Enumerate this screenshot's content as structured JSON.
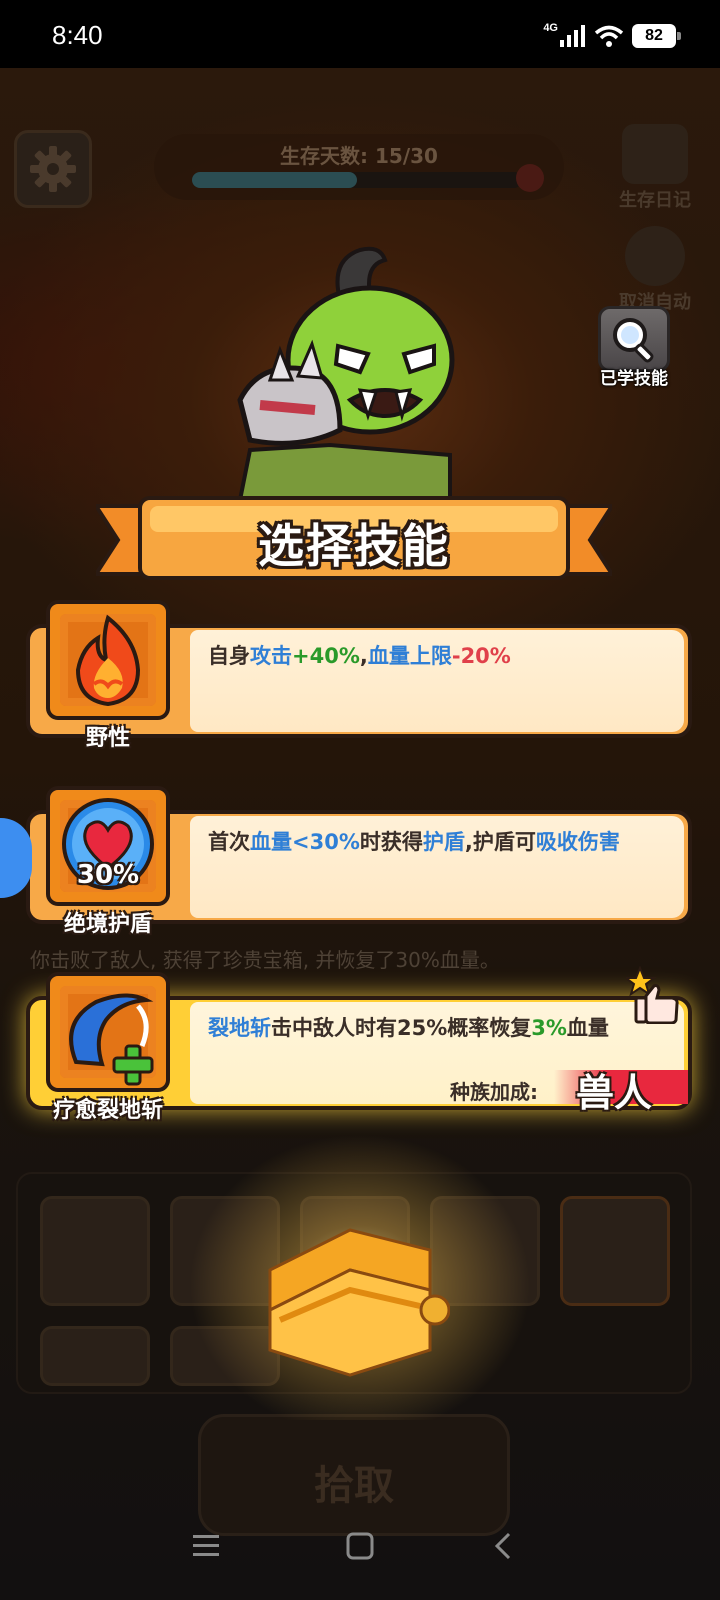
{
  "status_bar": {
    "time": "8:40",
    "network": "4G",
    "battery": "82"
  },
  "hud": {
    "survival_days_label": "生存天数: 15/30",
    "survival_progress": 0.5,
    "diary_label": "生存日记",
    "cancel_auto_label": "取消自动",
    "learned_skills_label": "已学技能"
  },
  "dialog": {
    "title": "选择技能",
    "skills": [
      {
        "name": "野性",
        "icon": "fire-icon",
        "desc_parts": [
          {
            "text": "自身",
            "color": "dark"
          },
          {
            "text": "攻击",
            "color": "blue"
          },
          {
            "text": "+40%",
            "color": "green"
          },
          {
            "text": ",",
            "color": "dark"
          },
          {
            "text": "血量上限",
            "color": "blue"
          },
          {
            "text": "-20%",
            "color": "red"
          }
        ]
      },
      {
        "name": "绝境护盾",
        "icon": "heart-shield-icon",
        "icon_text": "30%",
        "desc_parts": [
          {
            "text": "首次",
            "color": "dark"
          },
          {
            "text": "血量<30%",
            "color": "blue"
          },
          {
            "text": "时获得",
            "color": "dark"
          },
          {
            "text": "护盾",
            "color": "blue"
          },
          {
            "text": ",护盾可",
            "color": "dark"
          },
          {
            "text": "吸收伤害",
            "color": "blue"
          }
        ]
      },
      {
        "name": "疗愈裂地斩",
        "icon": "healing-slash-icon",
        "highlighted": true,
        "desc_parts": [
          {
            "text": "裂地斩",
            "color": "blue"
          },
          {
            "text": "击中敌人时有25%概率恢复",
            "color": "dark"
          },
          {
            "text": "3%",
            "color": "green"
          },
          {
            "text": "血量",
            "color": "dark"
          }
        ],
        "race_bonus_label": "种族加成:",
        "race_name": "兽人"
      }
    ]
  },
  "background": {
    "message": "你击败了敌人, 获得了珍贵宝箱, 并恢复了30%血量。",
    "pickup_label": "拾取"
  },
  "colors": {
    "card_orange": "#f7a948",
    "card_highlight": "#ffcf36",
    "text_blue": "#2f7fd6",
    "text_green": "#2a9a2a",
    "text_red": "#e0404a",
    "race_tag_red": "#e8283e"
  }
}
